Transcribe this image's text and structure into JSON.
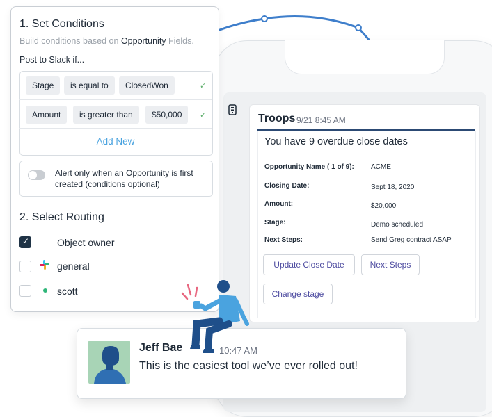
{
  "conditions_panel": {
    "title": "1. Set Conditions",
    "subtitle_prefix": "Build conditions based on ",
    "subtitle_object": "Opportunity",
    "subtitle_suffix": " Fields.",
    "post_label": "Post to Slack if...",
    "rows": [
      {
        "field": "Stage",
        "operator": "is equal to",
        "value": "ClosedWon",
        "check": "✓"
      },
      {
        "field": "Amount",
        "operator": "is greater than",
        "value": "$50,000",
        "check": "✓"
      }
    ],
    "add_new_label": "Add New",
    "alert_toggle_text": "Alert only when an Opportunity is first created (conditions optional)",
    "routing_title": "2. Select Routing",
    "routing": [
      {
        "label": "Object owner",
        "checked": true,
        "check_mark": "✓"
      },
      {
        "label": "general",
        "checked": false,
        "icon": "slack-icon"
      },
      {
        "label": "scott",
        "checked": false,
        "icon": "online-dot-icon"
      }
    ]
  },
  "slack_message": {
    "app_name": "Troops",
    "time": "9/21  8:45 AM",
    "title": "You have 9 overdue close dates",
    "fields": [
      {
        "label": "Opportunity Name ( 1 of 9):",
        "value": "ACME"
      },
      {
        "label": "Closing Date:",
        "value": "Sept 18, 2020"
      },
      {
        "label": "Amount:",
        "value": "$20,000"
      },
      {
        "label": "Stage:",
        "value": "Demo scheduled"
      },
      {
        "label": "Next Steps:",
        "value": "Send Greg contract ASAP"
      }
    ],
    "buttons": {
      "update_close_date": "Update Close Date",
      "next_steps": "Next Steps",
      "change_stage": "Change stage"
    }
  },
  "chat": {
    "name": "Jeff Bae",
    "time": "10:47 AM",
    "text": "This is the easiest tool we’ve ever rolled out!"
  },
  "colors": {
    "accent_blue": "#4aa3df",
    "button_text": "#4d4ba0",
    "checkbox_dark": "#1f3346",
    "check_green": "#5cae6a",
    "header_rule": "#2c4a74"
  }
}
